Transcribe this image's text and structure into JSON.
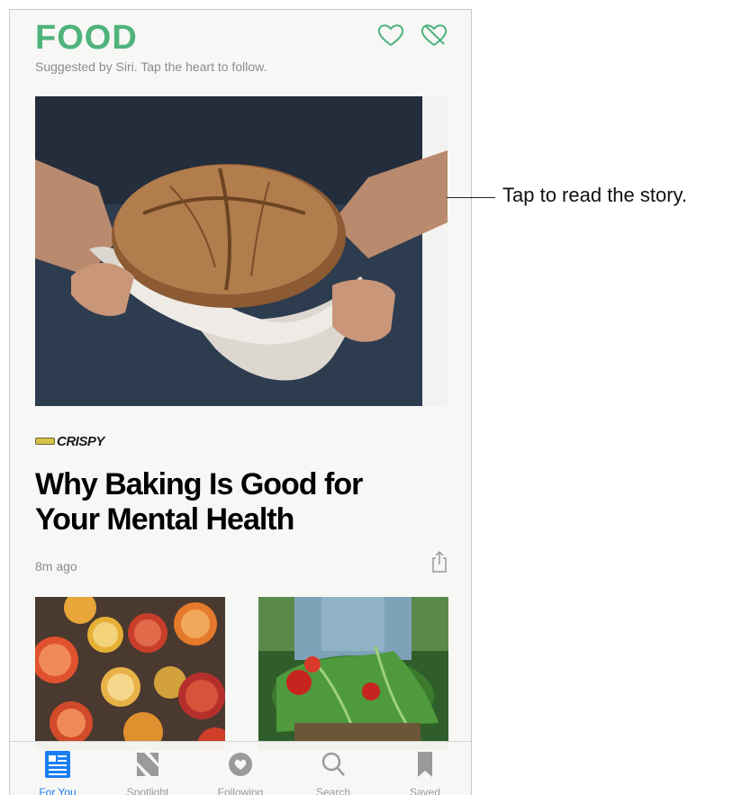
{
  "header": {
    "title": "FOOD",
    "subtitle": "Suggested by Siri. Tap the heart to follow.",
    "accent_color": "#4fb37c",
    "icons": [
      "heart-outline-icon",
      "heart-crossed-icon"
    ]
  },
  "story": {
    "image_icon": "bread-photo",
    "publisher": "CRISPY",
    "headline": "Why Baking Is Good for Your Mental Health",
    "time": "8m ago",
    "share_icon": "share-icon"
  },
  "more_stories": [
    {
      "image_icon": "citrus-photo"
    },
    {
      "image_icon": "vegetables-photo"
    }
  ],
  "tabbar": {
    "active_color": "#1a7ef2",
    "tabs": [
      {
        "label": "For You",
        "icon": "for-you-icon",
        "active": true
      },
      {
        "label": "Spotlight",
        "icon": "spotlight-icon",
        "active": false
      },
      {
        "label": "Following",
        "icon": "following-icon",
        "active": false
      },
      {
        "label": "Search",
        "icon": "search-icon",
        "active": false
      },
      {
        "label": "Saved",
        "icon": "saved-icon",
        "active": false
      }
    ]
  },
  "callout": {
    "text": "Tap to read the story."
  }
}
